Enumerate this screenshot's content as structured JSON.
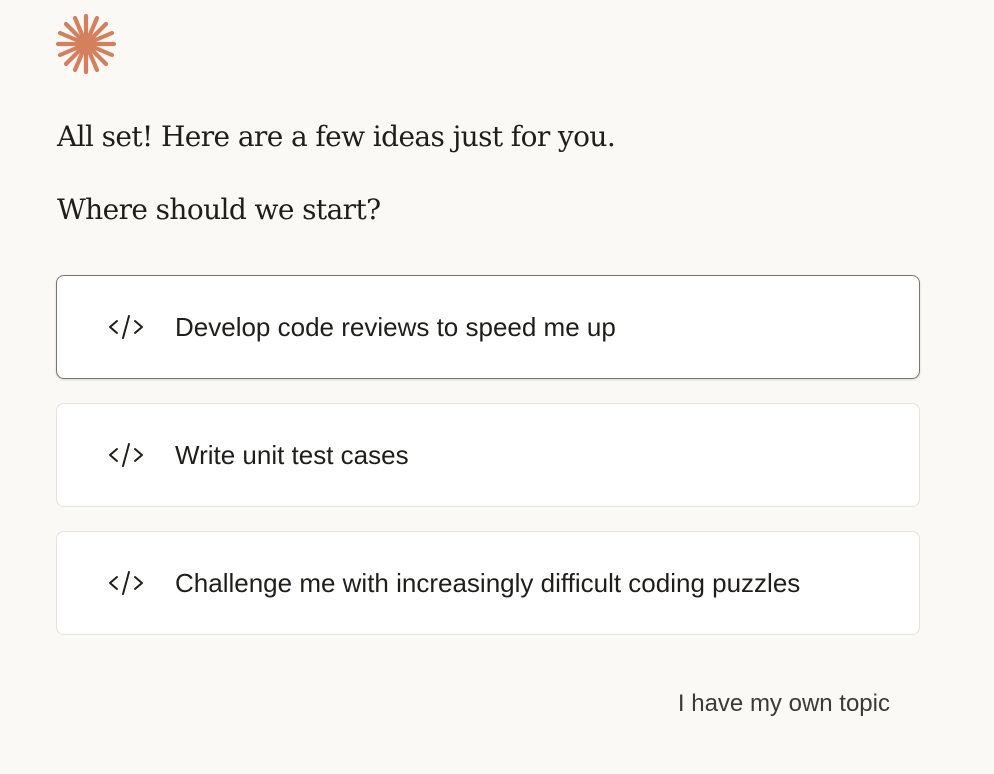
{
  "brand": {
    "logo_icon": "sparkle-asterisk-icon",
    "accent_color": "#d4805e"
  },
  "intro": {
    "line1": "All set! Here are a few ideas just for you.",
    "line2": "Where should we start?"
  },
  "options": [
    {
      "icon": "code-brackets-icon",
      "label": "Develop code reviews to speed me up"
    },
    {
      "icon": "code-brackets-icon",
      "label": "Write unit test cases"
    },
    {
      "icon": "code-brackets-icon",
      "label": "Challenge me with increasingly difficult coding puzzles"
    }
  ],
  "footer": {
    "own_topic_label": "I have my own topic"
  }
}
